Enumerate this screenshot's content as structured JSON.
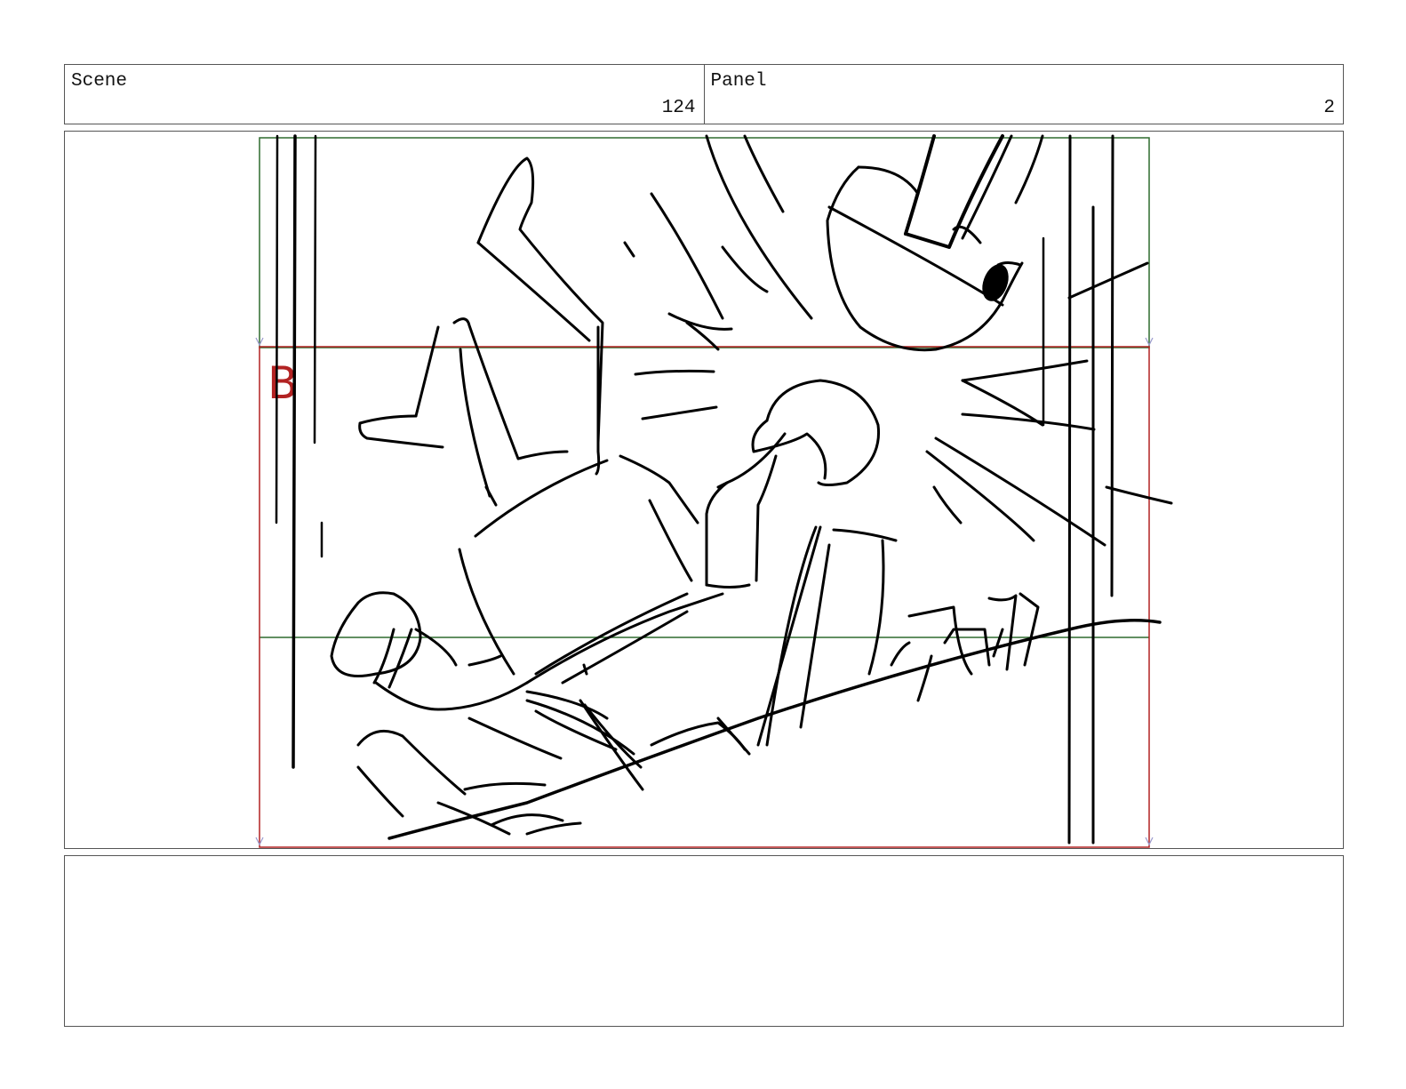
{
  "header": {
    "scene_label": "Scene",
    "scene_number": "124",
    "panel_label": "Panel",
    "panel_number": "2"
  },
  "panel": {
    "camera_label": "B"
  },
  "notes": {
    "text": ""
  },
  "colors": {
    "frame_border": "#555555",
    "camera_frame": "#b22222",
    "safe_frame": "#2e6b2e",
    "sketch_stroke": "#000000"
  },
  "icons": [
    "camera-marker-icon"
  ]
}
